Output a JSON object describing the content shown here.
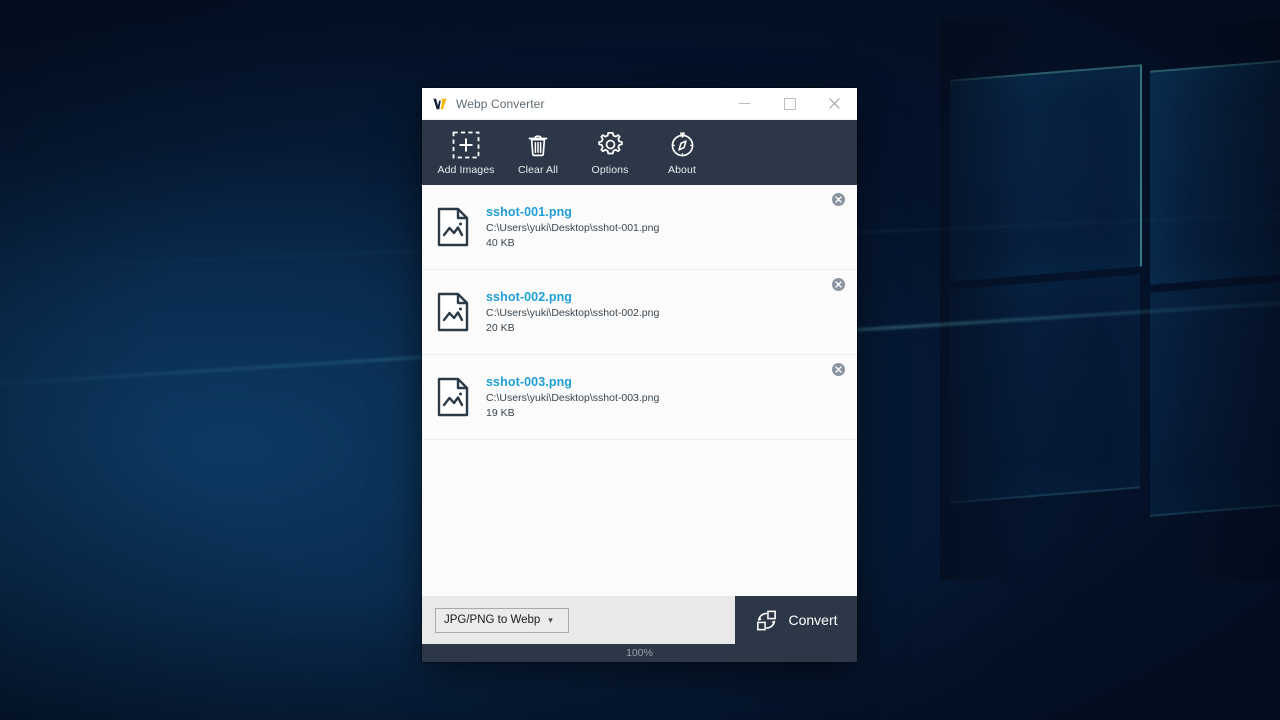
{
  "window": {
    "title": "Webp Converter",
    "logo_icon": "webp-w-logo",
    "controls": {
      "minimize": {
        "icon": "minimize-icon",
        "label": "Minimize"
      },
      "maximize": {
        "icon": "maximize-icon",
        "label": "Maximize"
      },
      "close": {
        "icon": "close-icon",
        "label": "Close"
      }
    }
  },
  "toolbar": {
    "items": [
      {
        "label": "Add Images",
        "icon": "add-images-icon"
      },
      {
        "label": "Clear All",
        "icon": "trash-icon"
      },
      {
        "label": "Options",
        "icon": "gear-icon"
      },
      {
        "label": "About",
        "icon": "compass-icon"
      }
    ]
  },
  "files": [
    {
      "name": "sshot-001.png",
      "path": "C:\\Users\\yuki\\Desktop\\sshot-001.png",
      "size": "40 KB",
      "icon": "image-file-icon",
      "remove_icon": "remove-circle-icon"
    },
    {
      "name": "sshot-002.png",
      "path": "C:\\Users\\yuki\\Desktop\\sshot-002.png",
      "size": "20 KB",
      "icon": "image-file-icon",
      "remove_icon": "remove-circle-icon"
    },
    {
      "name": "sshot-003.png",
      "path": "C:\\Users\\yuki\\Desktop\\sshot-003.png",
      "size": "19 KB",
      "icon": "image-file-icon",
      "remove_icon": "remove-circle-icon"
    }
  ],
  "bottom_bar": {
    "format_select": {
      "value": "JPG/PNG to Webp",
      "chevron_icon": "chevron-down-icon"
    },
    "convert_button": {
      "label": "Convert",
      "icon": "convert-icon"
    }
  },
  "status_bar": {
    "text": "100%"
  },
  "colors": {
    "toolbar_bg": "#2c3847",
    "accent_link": "#1f9fd6",
    "logo_gold": "#f2b705",
    "logo_navy": "#0d1b33",
    "list_bg": "#fbfbfb",
    "bottom_bar_bg": "#e9e9e9"
  }
}
